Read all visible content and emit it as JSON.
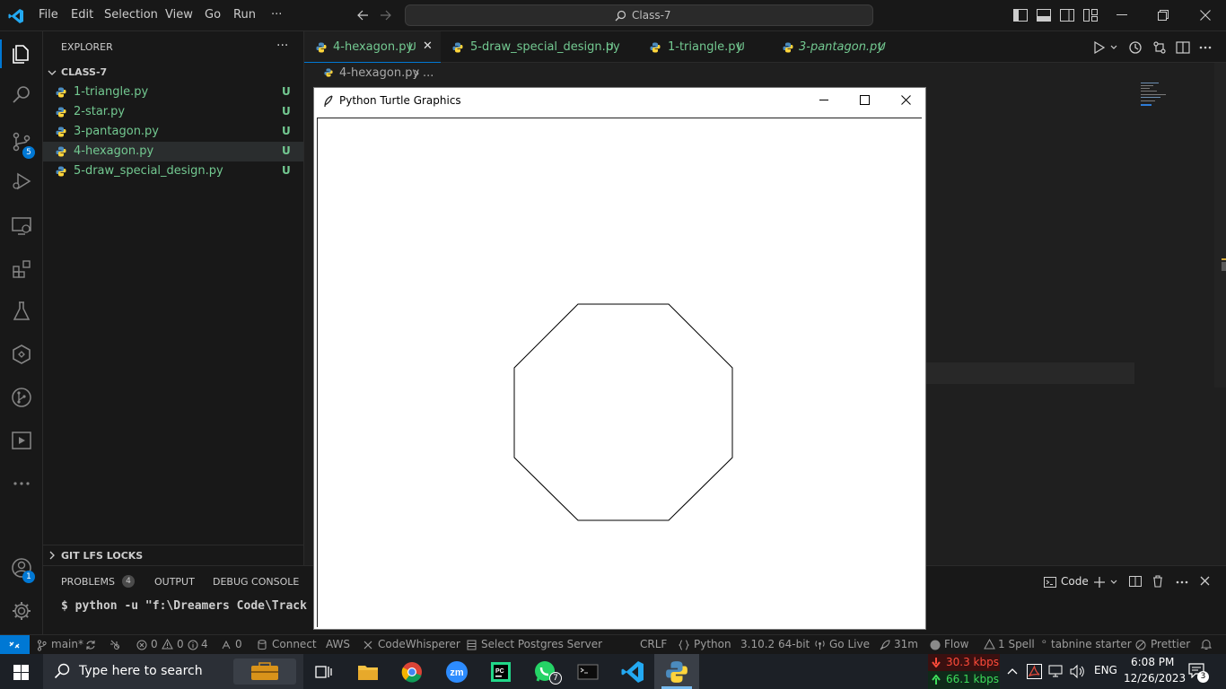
{
  "titlebar": {
    "menu": [
      "File",
      "Edit",
      "Selection",
      "View",
      "Go",
      "Run",
      "···"
    ],
    "search_text": "Class-7"
  },
  "activity": {
    "source_control_badge": "5",
    "accounts_badge": "1"
  },
  "sidebar": {
    "title": "EXPLORER",
    "more": "···",
    "folder": "CLASS-7",
    "files": [
      {
        "name": "1-triangle.py",
        "status": "U"
      },
      {
        "name": "2-star.py",
        "status": "U"
      },
      {
        "name": "3-pantagon.py",
        "status": "U"
      },
      {
        "name": "4-hexagon.py",
        "status": "U"
      },
      {
        "name": "5-draw_special_design.py",
        "status": "U"
      }
    ],
    "gitlfs": "GIT LFS LOCKS"
  },
  "tabs": [
    {
      "label": "4-hexagon.py",
      "status": "U",
      "close": "✕"
    },
    {
      "label": "5-draw_special_design.py",
      "status": "U"
    },
    {
      "label": "1-triangle.py",
      "status": "U"
    },
    {
      "label": "3-pantagon.py",
      "status": "U"
    }
  ],
  "breadcrumb": {
    "file": "4-hexagon.py",
    "rest": "..."
  },
  "turtle": {
    "title": "Python Turtle Graphics"
  },
  "panel": {
    "tabs": [
      "PROBLEMS",
      "OUTPUT",
      "DEBUG CONSOLE"
    ],
    "problems_count": "4",
    "terminal_line": "$ python -u \"f:\\Dreamers Code\\Track",
    "terminal_name": "Code"
  },
  "status": {
    "branch": "main*",
    "errors": "0",
    "warnings": "0",
    "info": "4",
    "ports": "0",
    "connect": "Connect",
    "aws": "AWS",
    "codewhisperer": "CodeWhisperer",
    "postgres": "Select Postgres Server",
    "eol": "CRLF",
    "lang": "Python",
    "pyver": "3.10.2 64-bit",
    "golive": "Go Live",
    "time": "31m",
    "flow": "Flow",
    "spell": "1 Spell",
    "tabnine": "tabnine starter",
    "prettier": "Prettier"
  },
  "taskbar": {
    "search": "Type here to search",
    "whatsapp_badge": "7",
    "net_down": "30.3 kbps",
    "net_up": "66.1 kbps",
    "lang": "ENG",
    "clock_time": "6:08 PM",
    "clock_date": "12/26/2023",
    "notif": "3"
  },
  "colors": {
    "accent": "#0078d4",
    "untracked": "#73c991",
    "bg": "#1f1f1f"
  }
}
